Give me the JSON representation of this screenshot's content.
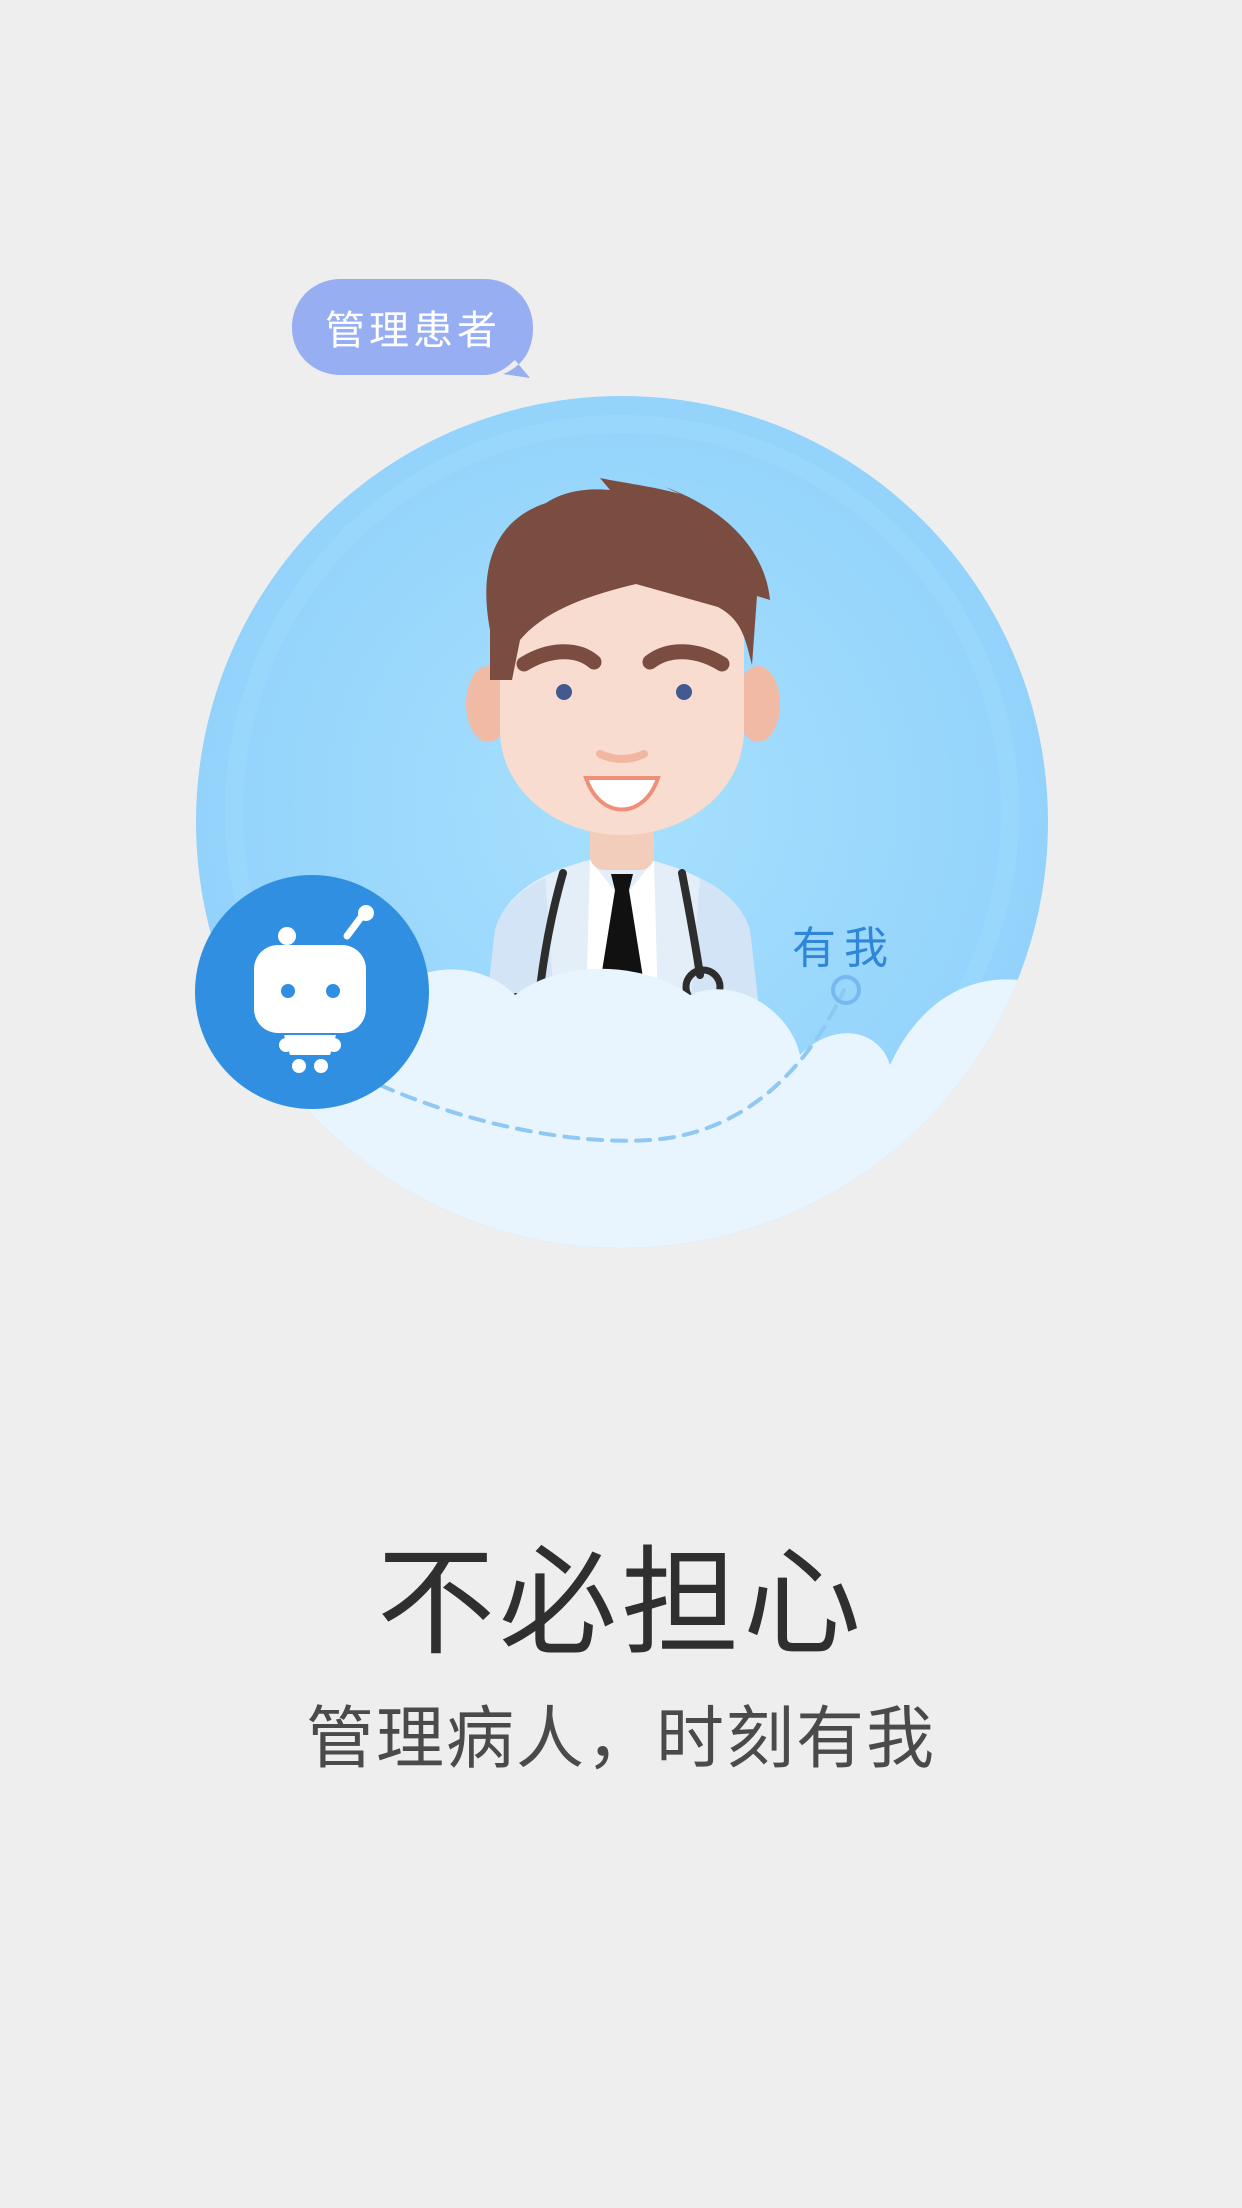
{
  "illustration": {
    "bubble_text": "管理患者",
    "scene_text": "有我",
    "main_character": "doctor",
    "badge_icon": "robot-icon"
  },
  "headline": {
    "title": "不必担心",
    "subtitle": "管理病人，时刻有我"
  },
  "colors": {
    "background": "#eeeeef",
    "bubble": "#97aef2",
    "circle_outer": "#91d3fc",
    "circle_inner": "#a5defe",
    "cloud": "#e8f5ff",
    "badge": "#318fe2",
    "hair": "#7b4d40",
    "skin": "#f7dacc",
    "title": "#2f2f2f",
    "subtitle": "#4a4a4a"
  }
}
